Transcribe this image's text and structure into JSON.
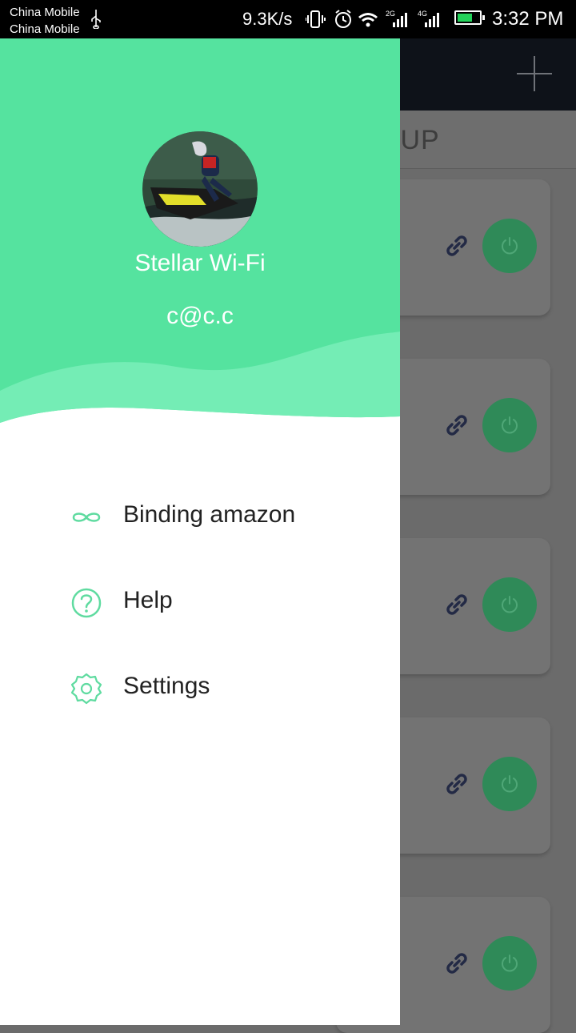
{
  "status_bar": {
    "carrier_1": "China Mobile",
    "carrier_2": "China Mobile",
    "net_speed": "9.3K/s",
    "signal_1_label": "2G",
    "signal_2_label": "4G",
    "time": "3:32 PM",
    "icons": [
      "usb-icon",
      "vibrate-icon",
      "alarm-icon",
      "wifi-icon",
      "signal-icon",
      "signal-icon",
      "battery-charging-icon"
    ]
  },
  "drawer": {
    "app_name": "Stellar Wi-Fi",
    "email": "c@c.c",
    "header_color": "#55e39f",
    "accent_color": "#5fdba0",
    "menu": [
      {
        "label": "Binding amazon",
        "icon": "infinity-icon"
      },
      {
        "label": "Help",
        "icon": "help-circle-icon"
      },
      {
        "label": "Settings",
        "icon": "gear-icon"
      }
    ]
  },
  "background_screen": {
    "group_header": "GROUP",
    "add_icon": "plus-icon",
    "device_cards": [
      {
        "link_icon": "link-icon",
        "power_icon": "power-icon"
      },
      {
        "link_icon": "link-icon",
        "power_icon": "power-icon"
      },
      {
        "link_icon": "link-icon",
        "power_icon": "power-icon"
      },
      {
        "link_icon": "link-icon",
        "power_icon": "power-icon"
      },
      {
        "link_icon": "link-icon",
        "power_icon": "power-icon"
      }
    ]
  }
}
